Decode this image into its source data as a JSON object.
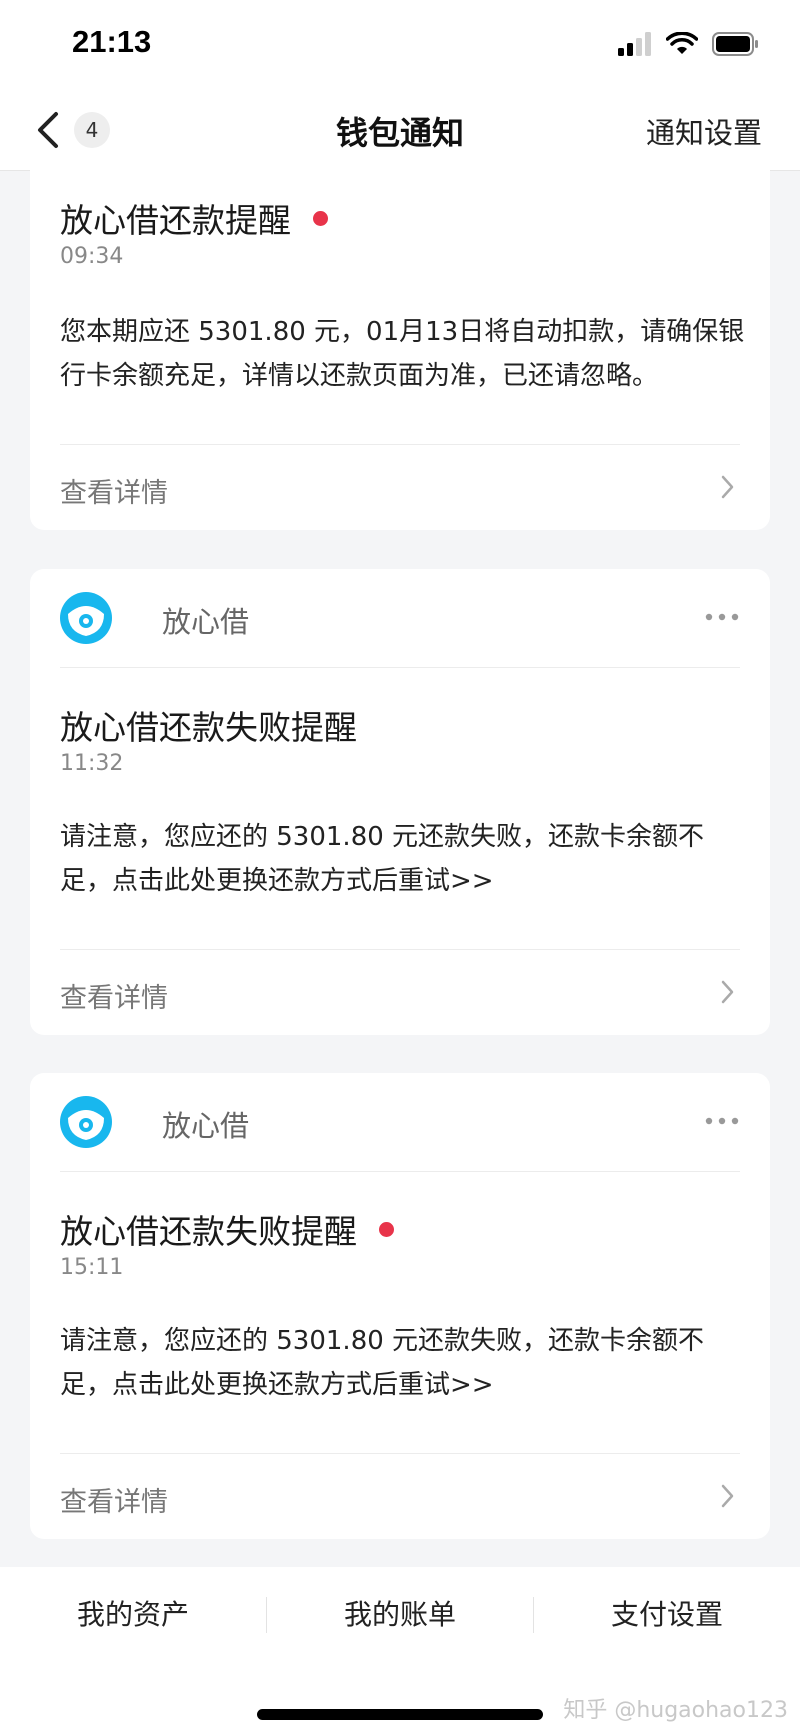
{
  "status_bar": {
    "time": "21:13"
  },
  "nav": {
    "badge_count": "4",
    "title": "钱包通知",
    "settings_label": "通知设置"
  },
  "cards": [
    {
      "title": "放心借还款提醒",
      "unread": true,
      "time": "09:34",
      "body": "您本期应还 5301.80 元，01月13日将自动扣款，请确保银行卡余额充足，详情以还款页面为准，已还请忽略。",
      "detail_label": "查看详情"
    },
    {
      "app_name": "放心借",
      "title": "放心借还款失败提醒",
      "unread": false,
      "time": "11:32",
      "body": "请注意，您应还的 5301.80 元还款失败，还款卡余额不足，点击此处更换还款方式后重试>>",
      "detail_label": "查看详情"
    },
    {
      "app_name": "放心借",
      "title": "放心借还款失败提醒",
      "unread": true,
      "time": "15:11",
      "body": "请注意，您应还的 5301.80 元还款失败，还款卡余额不足，点击此处更换还款方式后重试>>",
      "detail_label": "查看详情"
    }
  ],
  "tabbar": {
    "items": [
      "我的资产",
      "我的账单",
      "支付设置"
    ]
  },
  "watermark": "知乎 @hugaohao123",
  "colors": {
    "unread_dot": "#e8344a",
    "logo_blue": "#18b7ee",
    "page_bg": "#f4f5f7"
  }
}
